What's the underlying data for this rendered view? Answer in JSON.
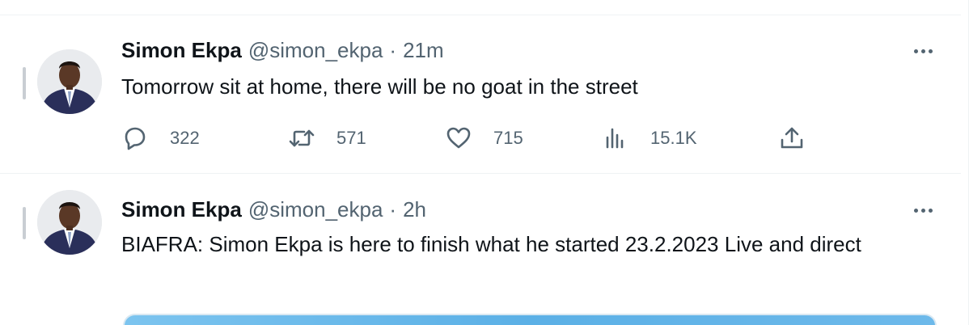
{
  "tweets": [
    {
      "name": "Simon Ekpa",
      "handle": "@simon_ekpa",
      "separator": "·",
      "time": "21m",
      "text": "Tomorrow sit at home, there will be no goat in the street",
      "actions": {
        "replies": "322",
        "retweets": "571",
        "likes": "715",
        "views": "15.1K"
      }
    },
    {
      "name": "Simon Ekpa",
      "handle": "@simon_ekpa",
      "separator": "·",
      "time": "2h",
      "text": "BIAFRA: Simon Ekpa is here to finish what he started 23.2.2023 Live and direct"
    }
  ],
  "colors": {
    "text": "#0f1419",
    "secondary": "#536471",
    "border": "#eff3f4",
    "media": "#5bb0e6"
  },
  "icons": {
    "reply": "reply-icon",
    "retweet": "retweet-icon",
    "like": "heart-icon",
    "views": "views-icon",
    "share": "share-icon",
    "more": "more-icon"
  }
}
